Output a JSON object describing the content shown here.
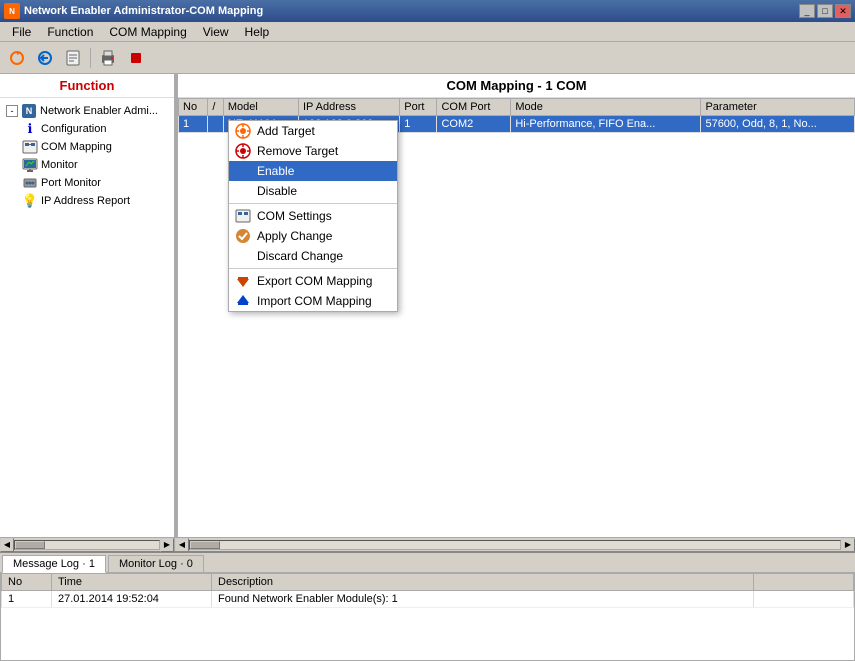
{
  "titleBar": {
    "icon": "NE",
    "title": "Network Enabler Administrator-COM Mapping",
    "controls": [
      "_",
      "□",
      "✕"
    ]
  },
  "menuBar": {
    "items": [
      "File",
      "Function",
      "COM Mapping",
      "View",
      "Help"
    ]
  },
  "toolbar": {
    "buttons": [
      {
        "name": "refresh-icon",
        "symbol": "↺"
      },
      {
        "name": "back-icon",
        "symbol": "↩"
      },
      {
        "name": "browse-icon",
        "symbol": "🖹"
      },
      {
        "name": "print-icon",
        "symbol": "🖶"
      },
      {
        "name": "stop-icon",
        "symbol": "⬛"
      }
    ]
  },
  "leftPanel": {
    "header": "Function",
    "tree": {
      "root": {
        "label": "Network Enabler Admi...",
        "expanded": true,
        "children": [
          {
            "label": "Configuration",
            "icon": "ℹ",
            "iconColor": "#0000cc"
          },
          {
            "label": "COM Mapping",
            "icon": "🔲",
            "iconColor": "#336699"
          },
          {
            "label": "Monitor",
            "icon": "📊",
            "iconColor": "#336699"
          },
          {
            "label": "Port Monitor",
            "icon": "🔌",
            "iconColor": "#336699"
          },
          {
            "label": "IP Address Report",
            "icon": "💡",
            "iconColor": "#cc9900"
          }
        ]
      }
    }
  },
  "rightPanel": {
    "header": "COM Mapping - 1 COM",
    "tableColumns": [
      "No",
      "/",
      "Model",
      "IP Address",
      "Port",
      "COM Port",
      "Mode",
      "Parameter"
    ],
    "tableRows": [
      {
        "no": "1",
        "flag": "",
        "model": "NE-4110A",
        "ip": "192.168.0.209",
        "port": "1",
        "comPort": "COM2",
        "mode": "Hi-Performance, FIFO Ena...",
        "parameter": "57600, Odd, 8, 1, No...",
        "selected": true
      }
    ]
  },
  "contextMenu": {
    "items": [
      {
        "label": "Add Target",
        "icon": "➕",
        "hasIcon": true,
        "disabled": false
      },
      {
        "label": "Remove Target",
        "icon": "✖",
        "hasIcon": true,
        "disabled": false
      },
      {
        "label": "Enable",
        "highlighted": true,
        "hasIcon": false,
        "disabled": false
      },
      {
        "label": "Disable",
        "hasIcon": false,
        "disabled": false
      },
      {
        "separator": true
      },
      {
        "label": "COM Settings",
        "icon": "⚙",
        "hasIcon": true,
        "disabled": false
      },
      {
        "label": "Apply Change",
        "icon": "✔",
        "hasIcon": true,
        "disabled": false
      },
      {
        "label": "Discard Change",
        "hasIcon": false,
        "disabled": false
      },
      {
        "separator": true
      },
      {
        "label": "Export COM Mapping",
        "icon": "▲",
        "hasIcon": true,
        "disabled": false
      },
      {
        "label": "Import COM Mapping",
        "icon": "▼",
        "hasIcon": true,
        "disabled": false
      }
    ]
  },
  "bottomTabs": [
    {
      "label": "Message Log · 1",
      "active": true
    },
    {
      "label": "Monitor Log · 0",
      "active": false
    }
  ],
  "logTable": {
    "columns": [
      "No",
      "Time",
      "Description"
    ],
    "rows": [
      {
        "no": "1",
        "time": "27.01.2014 19:52:04",
        "description": "Found Network Enabler Module(s): 1"
      }
    ]
  }
}
